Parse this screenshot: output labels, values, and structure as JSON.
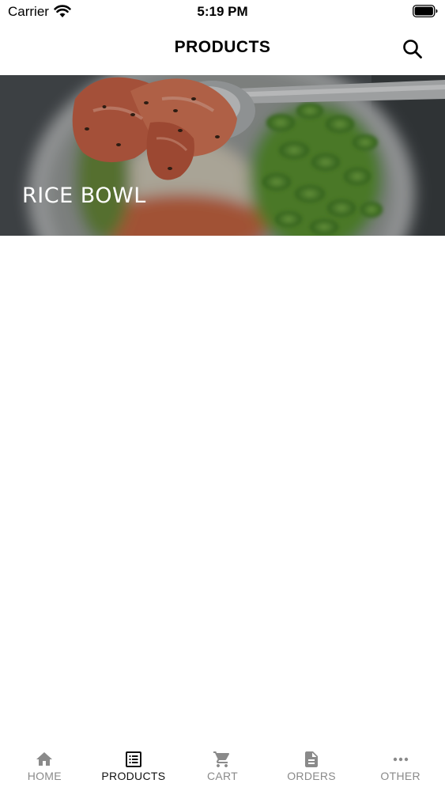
{
  "status_bar": {
    "carrier": "Carrier",
    "time": "5:19 PM"
  },
  "header": {
    "title": "PRODUCTS",
    "search_icon": "search-icon"
  },
  "categories": [
    {
      "label": "RICE BOWL"
    }
  ],
  "tab_bar": {
    "tabs": [
      {
        "label": "HOME",
        "icon": "home-icon",
        "active": false
      },
      {
        "label": "PRODUCTS",
        "icon": "list-icon",
        "active": true
      },
      {
        "label": "CART",
        "icon": "cart-icon",
        "active": false
      },
      {
        "label": "ORDERS",
        "icon": "document-icon",
        "active": false
      },
      {
        "label": "OTHER",
        "icon": "more-icon",
        "active": false
      }
    ],
    "active_color": "#111111",
    "inactive_color": "#8a8a8a"
  }
}
